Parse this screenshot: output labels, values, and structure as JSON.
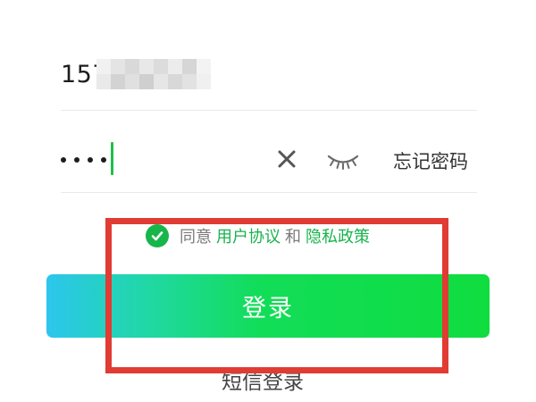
{
  "login_form": {
    "phone_value": "157",
    "password_mask": "••••",
    "forgot_password_label": "忘记密码",
    "agreement": {
      "agree_prefix": "同意",
      "user_agreement_link": "用户协议",
      "conjunction": "和",
      "privacy_policy_link": "隐私政策",
      "checked": true
    },
    "login_button_label": "登录",
    "sms_login_label": "短信登录"
  },
  "icons": {
    "clear": "close-icon",
    "password_visibility": "eye-closed-icon",
    "agreement_check": "check-icon"
  },
  "colors": {
    "accent_green": "#19b24c",
    "button_gradient_start": "#2cc6ee",
    "button_gradient_end": "#0fdd3f",
    "caret": "#1fbf4a",
    "annotation_red": "#e03c33"
  }
}
